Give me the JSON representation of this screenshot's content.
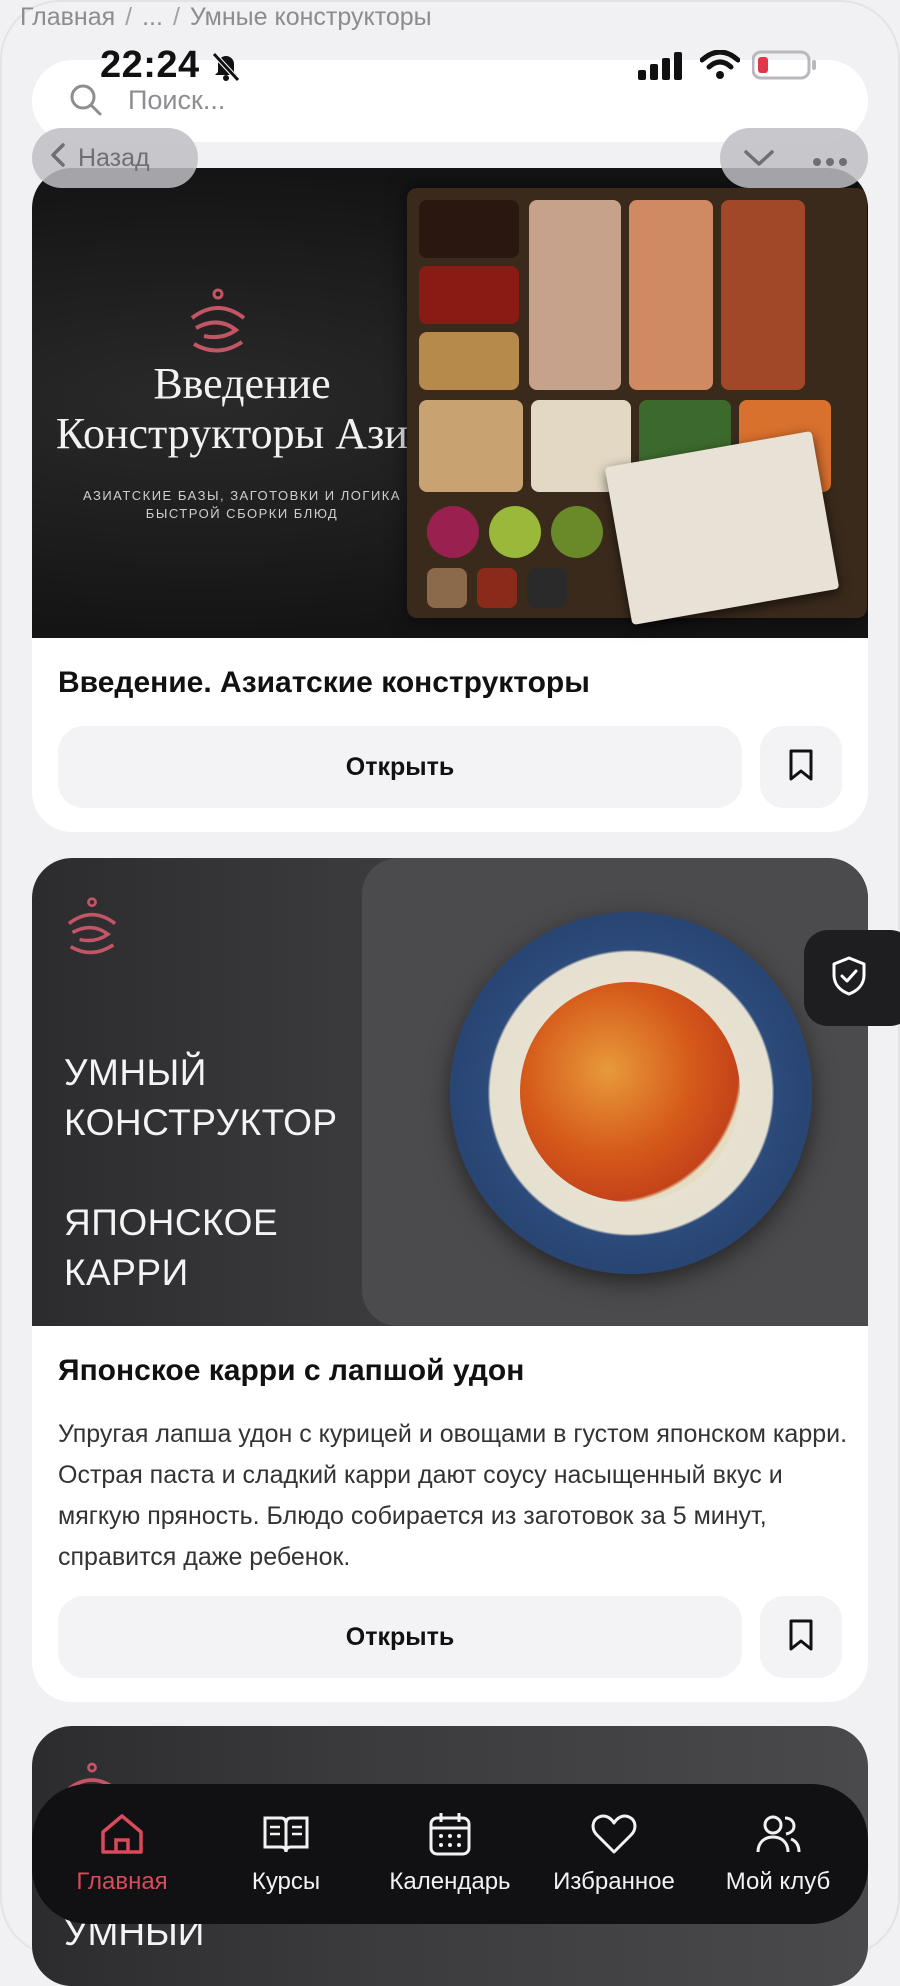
{
  "breadcrumb": {
    "home": "Главная",
    "ellipsis": "...",
    "current": "Умные конструкторы",
    "sep": "/"
  },
  "status": {
    "time": "22:24"
  },
  "search": {
    "placeholder": "Поиск..."
  },
  "top_controls": {
    "back_label": "Назад"
  },
  "cards": [
    {
      "hero": {
        "title_line1": "Введение",
        "title_line2": "Конструкторы Азия",
        "subtitle_line1": "АЗИАТСКИЕ БАЗЫ, ЗАГОТОВКИ И ЛОГИКА",
        "subtitle_line2": "БЫСТРОЙ СБОРКИ БЛЮД"
      },
      "title": "Введение. Азиатские конструкторы",
      "open_label": "Открыть"
    },
    {
      "hero": {
        "line1": "УМНЫЙ",
        "line2": "КОНСТРУКТОР",
        "line3": "ЯПОНСКОЕ",
        "line4": "КАРРИ"
      },
      "title": "Японское карри с лапшой удон",
      "description": "Упругая лапша удон с курицей и овощами в густом японском карри. Острая паста и сладкий карри дают соусу насыщенный вкус и мягкую пряность. Блюдо собирается из заготовок за 5 минут, справится даже ребенок.",
      "open_label": "Открыть"
    },
    {
      "hero": {
        "line1": "УМНЫЙ"
      }
    }
  ],
  "bottom_nav": [
    {
      "label": "Главная",
      "icon": "home-icon",
      "active": true
    },
    {
      "label": "Курсы",
      "icon": "book-icon",
      "active": false
    },
    {
      "label": "Календарь",
      "icon": "calendar-icon",
      "active": false
    },
    {
      "label": "Избранное",
      "icon": "heart-icon",
      "active": false
    },
    {
      "label": "Мой клуб",
      "icon": "users-icon",
      "active": false
    }
  ],
  "colors": {
    "accent": "#d94a5a",
    "nav_bg": "#111113",
    "page_bg": "#f1f1f3"
  }
}
